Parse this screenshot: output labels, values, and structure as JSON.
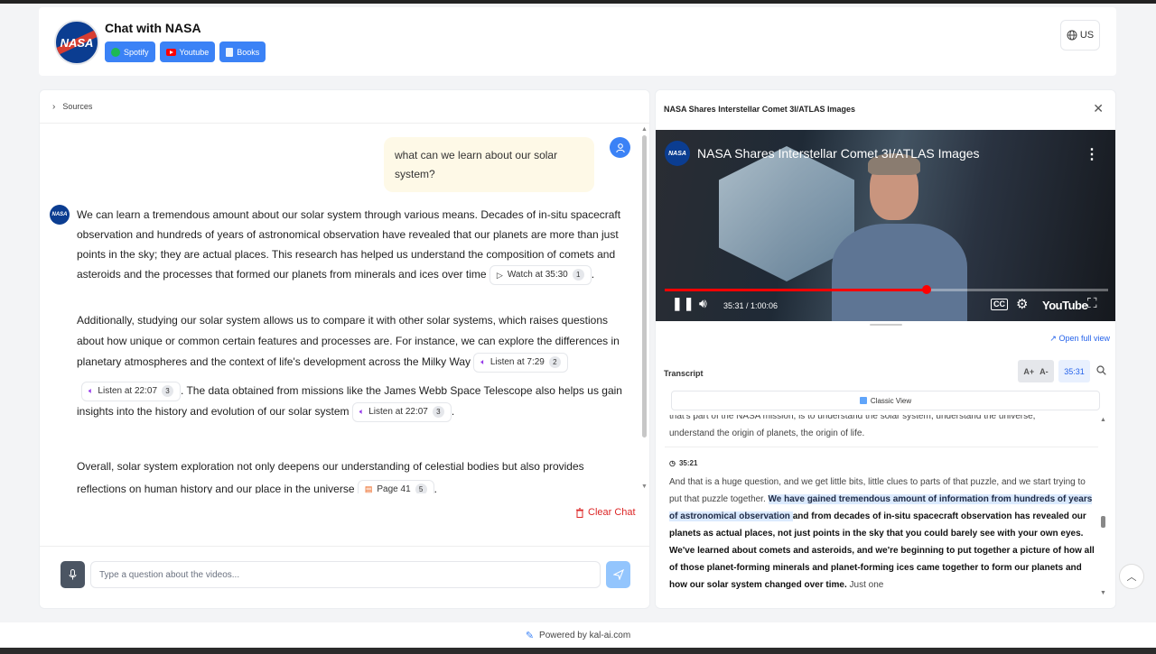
{
  "header": {
    "title": "Chat with NASA",
    "logo_text": "NASA",
    "links": [
      {
        "label": "Spotify",
        "icon": "spotify-icon",
        "color": "#1db954"
      },
      {
        "label": "Youtube",
        "icon": "youtube-icon",
        "color": "#ff0000"
      },
      {
        "label": "Books",
        "icon": "book-icon",
        "color": "#ffffff"
      }
    ],
    "locale": "US"
  },
  "chat": {
    "sources_label": "Sources",
    "user_message": "what can we learn about our solar system?",
    "bot_paragraphs": {
      "p1": "We can learn a tremendous amount about our solar system through various means. Decades of in-situ spacecraft observation and hundreds of years of astronomical observation have revealed that our planets are more than just points in the sky; they are actual places. This research has helped us understand the composition of comets and asteroids and the processes that formed our planets from minerals and ices over time",
      "p2a": "Additionally, studying our solar system allows us to compare it with other solar systems, which raises questions about how unique or common certain features and processes are. For instance, we can explore the differences in planetary atmospheres and the context of life's development across the Milky Way",
      "p2b": ". The data obtained from missions like the James Webb Space Telescope also helps us gain insights into the history and evolution of our solar system",
      "p3": "Overall, solar system exploration not only deepens our understanding of celestial bodies but also provides reflections on human history and our place in the universe"
    },
    "citations": {
      "c1": {
        "label": "Watch at 35:30",
        "num": "1",
        "icon": "play-icon"
      },
      "c2": {
        "label": "Listen at 7:29",
        "num": "2",
        "icon": "speaker-icon"
      },
      "c3": {
        "label": "Listen at 22:07",
        "num": "3",
        "icon": "speaker-icon"
      },
      "c4": {
        "label": "Listen at 22:07",
        "num": "3",
        "icon": "speaker-icon"
      },
      "c5": {
        "label": "Page 41",
        "num": "5",
        "icon": "document-icon"
      }
    },
    "period": ".",
    "clear_label": "Clear Chat",
    "input_placeholder": "Type a question about the videos..."
  },
  "video": {
    "panel_title": "NASA Shares Interstellar Comet 3I/ATLAS Images",
    "player_title": "NASA Shares Interstellar Comet 3I/ATLAS Images",
    "channel_logo": "NASA",
    "time_display": "35:31 / 1:00:06",
    "progress_fraction": 0.59,
    "brand": "YouTube",
    "open_full": "Open full view"
  },
  "transcript": {
    "label": "Transcript",
    "font_up": "A+",
    "font_down": "A-",
    "current_time": "35:31",
    "classic_view": "Classic View",
    "prev_cut": "that's part of the NASA mission, is to understand the solar system, understand the universe,",
    "prev_text": "understand the origin of planets, the origin of life.",
    "timestamp": "35:21",
    "seg_plain1": "And that is a huge question, and we get little bits, little clues to parts of that puzzle,  and we start trying to put that puzzle together. ",
    "seg_highlight": "We have gained tremendous amount of information from hundreds of years of astronomical observation ",
    "seg_bold": "and from decades of in-situ spacecraft observation has revealed our planets as actual places, not just points in the sky that you could barely see with your own eyes. We've learned about comets and asteroids, and we're beginning to put together a picture of how all of those planet-forming minerals and planet-forming ices came together to form our planets and how our solar system changed over time.",
    "seg_plain2": " Just one"
  },
  "footer": {
    "text": "Powered by kal-ai.com"
  }
}
